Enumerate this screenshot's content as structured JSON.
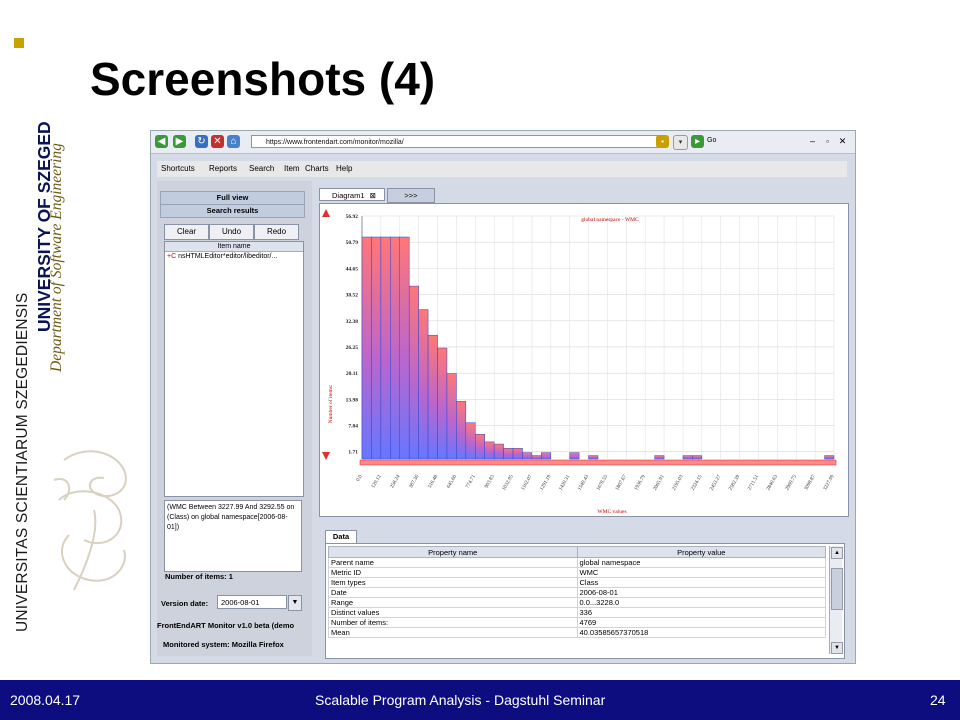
{
  "slide": {
    "title": "Screenshots (4)",
    "side_text_latin": "UNIVERSITAS SCIENTIARUM SZEGEDIENSIS",
    "side_text_university": "UNIVERSITY OF SZEGED",
    "side_text_department": "Department of Software Engineering",
    "footer_date": "2008.04.17",
    "footer_title": "Scalable Program Analysis - Dagstuhl Seminar",
    "page_number": "24"
  },
  "browser": {
    "address": "https://www.frontendart.com/monitor/mozilla/",
    "go_label": "Go",
    "icons": [
      "back-icon",
      "forward-icon",
      "refresh-icon",
      "stop-icon",
      "home-icon",
      "lock-icon",
      "go-icon",
      "minimize-icon",
      "close-icon"
    ]
  },
  "app": {
    "menu": [
      "Shortcuts",
      "Reports",
      "Search",
      "Item",
      "Charts",
      "Help"
    ],
    "left": {
      "tab_full": "Full view",
      "tab_search": "Search results",
      "btn_clear": "Clear",
      "btn_undo": "Undo",
      "btn_redo": "Redo",
      "list_header": "Item name",
      "list_item_prefix": "+C",
      "list_item": "nsHTMLEditor*editor/libeditor/...",
      "query": "(WMC Between 3227.99 And 3292.55 on (Class) on global namespace[2006-08-01])",
      "num_items": "Number of items: 1",
      "version_label": "Version date:",
      "version_value": "2006-08-01",
      "about": "FrontEndART Monitor v1.0 beta (demo",
      "monitored": "Monitored system: Mozilla Firefox"
    },
    "tabs": {
      "diagram": "Diagram1",
      "more": ">>>"
    },
    "data_tab": "Data",
    "table": {
      "headers": [
        "Property name",
        "Property value"
      ],
      "rows": [
        [
          "Parent name",
          "global namespace"
        ],
        [
          "Metric ID",
          "WMC"
        ],
        [
          "Item types",
          "Class"
        ],
        [
          "Date",
          "2006-08-01"
        ],
        [
          "Range",
          "0.0...3228.0"
        ],
        [
          "Distinct values",
          "336"
        ],
        [
          "Number of items:",
          "4769"
        ],
        [
          "Mean",
          "40.03585657370518"
        ]
      ]
    }
  },
  "chart_data": {
    "type": "bar",
    "title": "global namespace - WMC",
    "xlabel": "WMC values",
    "ylabel": "Number of items:",
    "ylim": [
      0,
      56.92
    ],
    "y_ticks": [
      "56.92",
      "50.79",
      "44.65",
      "38.52",
      "32.38",
      "26.25",
      "20.11",
      "13.98",
      "7.84",
      "1.71"
    ],
    "x_ticks": [
      "0.0",
      "129.12",
      "258.24",
      "387.36",
      "516.48",
      "645.60",
      "774.71",
      "903.83",
      "1032.95",
      "1162.07",
      "1291.19",
      "1420.31",
      "1549.43",
      "1678.55",
      "1807.67",
      "1936.79",
      "2065.91",
      "2195.03",
      "2324.15",
      "2453.27",
      "2582.39",
      "2711.51",
      "2840.63",
      "2969.75",
      "3098.87",
      "3227.99"
    ],
    "bins": 50,
    "values": [
      52,
      52,
      52,
      52,
      52,
      40.5,
      35,
      29,
      26,
      20,
      13.5,
      8.5,
      5.8,
      4,
      3.5,
      2.5,
      2.5,
      1.5,
      0.8,
      1.5,
      0,
      0,
      1.5,
      0,
      0.8,
      0,
      0,
      0,
      0,
      0,
      0,
      0.8,
      0,
      0,
      0.8,
      0.8,
      0,
      0,
      0,
      0,
      0,
      0,
      0,
      0,
      0,
      0,
      0,
      0,
      0,
      0.8
    ],
    "grid": true
  }
}
